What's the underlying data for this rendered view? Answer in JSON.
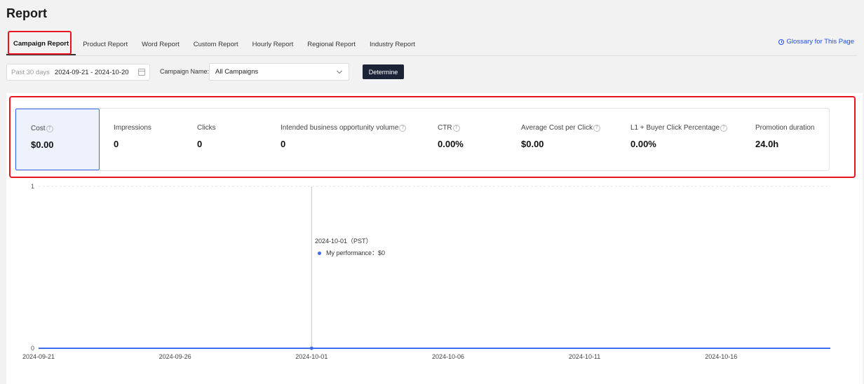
{
  "page": {
    "title": "Report"
  },
  "tabs": [
    {
      "label": "Campaign Report",
      "active": true
    },
    {
      "label": "Product Report"
    },
    {
      "label": "Word Report"
    },
    {
      "label": "Custom Report"
    },
    {
      "label": "Hourly Report"
    },
    {
      "label": "Regional Report"
    },
    {
      "label": "Industry Report"
    }
  ],
  "glossary": {
    "label": "Glossary for This Page",
    "icon": "clock-icon"
  },
  "filters": {
    "date_range_label": "Past 30 days",
    "date_range_value": "2024-09-21 - 2024-10-20",
    "campaign_label": "Campaign Name:",
    "campaign_value": "All Campaigns",
    "determine_label": "Determine"
  },
  "metrics": [
    {
      "label": "Cost",
      "value": "$0.00",
      "help": true,
      "active": true
    },
    {
      "label": "Impressions",
      "value": "0"
    },
    {
      "label": "Clicks",
      "value": "0"
    },
    {
      "label": "Intended business opportunity volume",
      "value": "0",
      "help": true
    },
    {
      "label": "CTR",
      "value": "0.00%",
      "help": true
    },
    {
      "label": "Average Cost per Click",
      "value": "$0.00",
      "help": true
    },
    {
      "label": "L1 + Buyer Click Percentage",
      "value": "0.00%",
      "help": true
    },
    {
      "label": "Promotion duration",
      "value": "24.0h"
    }
  ],
  "tooltip": {
    "date": "2024-10-01（PST）",
    "series_label": "My performance：$0"
  },
  "colors": {
    "accent": "#3e6cf0",
    "annotation": "#e8141f",
    "button_dark": "#1b2337",
    "link": "#1d4fd8"
  },
  "chart_data": {
    "type": "line",
    "x": [
      "2024-09-21",
      "2024-09-22",
      "2024-09-23",
      "2024-09-24",
      "2024-09-25",
      "2024-09-26",
      "2024-09-27",
      "2024-09-28",
      "2024-09-29",
      "2024-09-30",
      "2024-10-01",
      "2024-10-02",
      "2024-10-03",
      "2024-10-04",
      "2024-10-05",
      "2024-10-06",
      "2024-10-07",
      "2024-10-08",
      "2024-10-09",
      "2024-10-10",
      "2024-10-11",
      "2024-10-12",
      "2024-10-13",
      "2024-10-14",
      "2024-10-15",
      "2024-10-16",
      "2024-10-17",
      "2024-10-18",
      "2024-10-19",
      "2024-10-20"
    ],
    "xticks": [
      "2024-09-21",
      "2024-09-26",
      "2024-10-01",
      "2024-10-06",
      "2024-10-11",
      "2024-10-16"
    ],
    "series": [
      {
        "values": [
          0,
          0,
          0,
          0,
          0,
          0,
          0,
          0,
          0,
          0,
          0,
          0,
          0,
          0,
          0,
          0,
          0,
          0,
          0,
          0,
          0,
          0,
          0,
          0,
          0,
          0,
          0,
          0,
          0,
          0
        ]
      }
    ],
    "ylim": [
      0,
      1
    ],
    "yticks": [
      "0",
      "1"
    ],
    "highlight": "2024-10-01",
    "grid": true
  }
}
